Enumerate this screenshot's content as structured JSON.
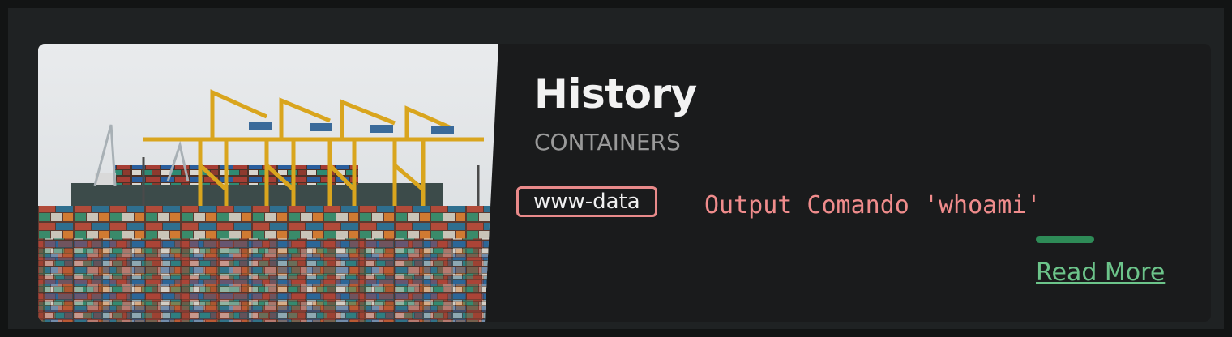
{
  "card": {
    "title": "History",
    "subtitle": "CONTAINERS",
    "user_badge": "www-data",
    "command_output": "Output Comando 'whoami'",
    "read_more_label": "Read More",
    "image_subject": "container-port-photo"
  },
  "colors": {
    "page_background": "#121414",
    "frame_background": "#1f2223",
    "card_background": "#1a1b1c",
    "badge_border": "#e98a8a",
    "command_text": "#f08c8c",
    "accent_bar": "#2e8b57",
    "link": "#6cc48a"
  }
}
